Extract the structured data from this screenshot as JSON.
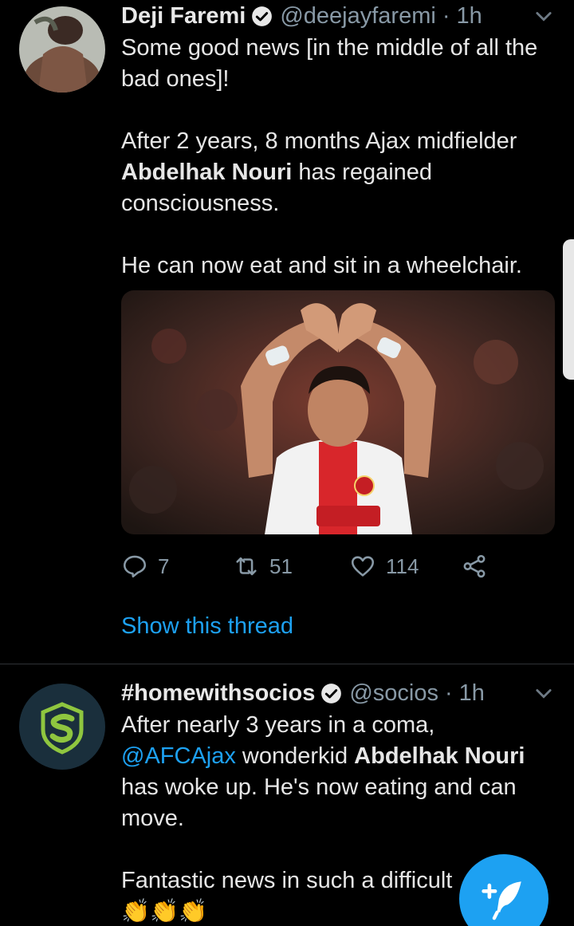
{
  "tweets": [
    {
      "name": "Deji Faremi",
      "handle": "@deejayfaremi",
      "time": "· 1h",
      "text": {
        "line1": "Some good news [in the middle of all the bad ones]!",
        "line2_pre": "After 2 years, 8 months Ajax midfielder ",
        "line2_bold": "Abdelhak Nouri",
        "line2_post": " has regained consciousness.",
        "line3": "He can now eat and sit in a wheelchair."
      },
      "stats": {
        "replies": "7",
        "retweets": "51",
        "likes": "114"
      },
      "show_thread": "Show this thread"
    },
    {
      "name": "#homewithsocios",
      "handle": "@socios",
      "time": "· 1h",
      "text": {
        "line1": "After nearly 3 years in a coma,",
        "mention": "@AFCAjax",
        "mid": " wonderkid ",
        "bold": "Abdelhak Nouri",
        "line2_post": " has woke up. He's now eating and can move.",
        "line3": "Fantastic news in such a difficult",
        "emoji": "👏👏👏"
      }
    }
  ],
  "colors": {
    "accent": "#1da1f2",
    "muted": "#8899a6",
    "background": "#000000"
  }
}
